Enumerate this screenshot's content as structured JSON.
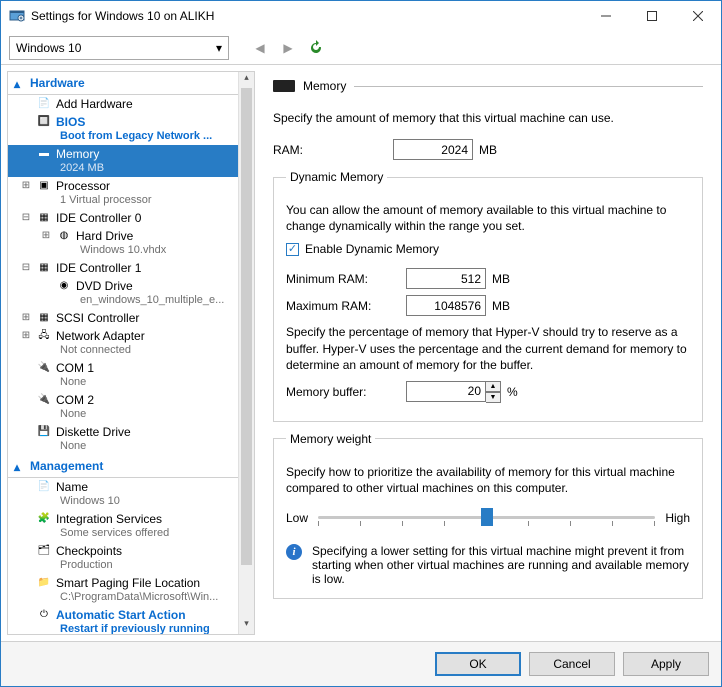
{
  "title": "Settings for Windows 10 on ALIKH",
  "dropdown": {
    "value": "Windows 10"
  },
  "tree": {
    "hardware_label": "Hardware",
    "management_label": "Management",
    "items": {
      "add_hw": {
        "label": "Add Hardware"
      },
      "bios": {
        "label": "BIOS",
        "sub": "Boot from Legacy Network ..."
      },
      "memory": {
        "label": "Memory",
        "sub": "2024 MB"
      },
      "processor": {
        "label": "Processor",
        "sub": "1 Virtual processor"
      },
      "ide0": {
        "label": "IDE Controller 0"
      },
      "hd": {
        "label": "Hard Drive",
        "sub": "Windows 10.vhdx"
      },
      "ide1": {
        "label": "IDE Controller 1"
      },
      "dvd": {
        "label": "DVD Drive",
        "sub": "en_windows_10_multiple_e..."
      },
      "scsi": {
        "label": "SCSI Controller"
      },
      "net": {
        "label": "Network Adapter",
        "sub": "Not connected"
      },
      "com1": {
        "label": "COM 1",
        "sub": "None"
      },
      "com2": {
        "label": "COM 2",
        "sub": "None"
      },
      "disk": {
        "label": "Diskette Drive",
        "sub": "None"
      },
      "name": {
        "label": "Name",
        "sub": "Windows 10"
      },
      "integ": {
        "label": "Integration Services",
        "sub": "Some services offered"
      },
      "check": {
        "label": "Checkpoints",
        "sub": "Production"
      },
      "smart": {
        "label": "Smart Paging File Location",
        "sub": "C:\\ProgramData\\Microsoft\\Win..."
      },
      "autostart": {
        "label": "Automatic Start Action",
        "sub": "Restart if previously running"
      }
    }
  },
  "panel": {
    "title": "Memory",
    "specify": "Specify the amount of memory that this virtual machine can use.",
    "ram_label": "RAM:",
    "ram_value": "2024",
    "mb": "MB",
    "dynamic": {
      "legend": "Dynamic Memory",
      "desc": "You can allow the amount of memory available to this virtual machine to change dynamically within the range you set.",
      "enable": "Enable Dynamic Memory",
      "min_label": "Minimum RAM:",
      "min_value": "512",
      "max_label": "Maximum RAM:",
      "max_value": "1048576",
      "buffer_desc": "Specify the percentage of memory that Hyper-V should try to reserve as a buffer. Hyper-V uses the percentage and the current demand for memory to determine an amount of memory for the buffer.",
      "buffer_label": "Memory buffer:",
      "buffer_value": "20",
      "pct": "%"
    },
    "weight": {
      "legend": "Memory weight",
      "desc": "Specify how to prioritize the availability of memory for this virtual machine compared to other virtual machines on this computer.",
      "low": "Low",
      "high": "High",
      "info": "Specifying a lower setting for this virtual machine might prevent it from starting when other virtual machines are running and available memory is low."
    }
  },
  "buttons": {
    "ok": "OK",
    "cancel": "Cancel",
    "apply": "Apply"
  }
}
